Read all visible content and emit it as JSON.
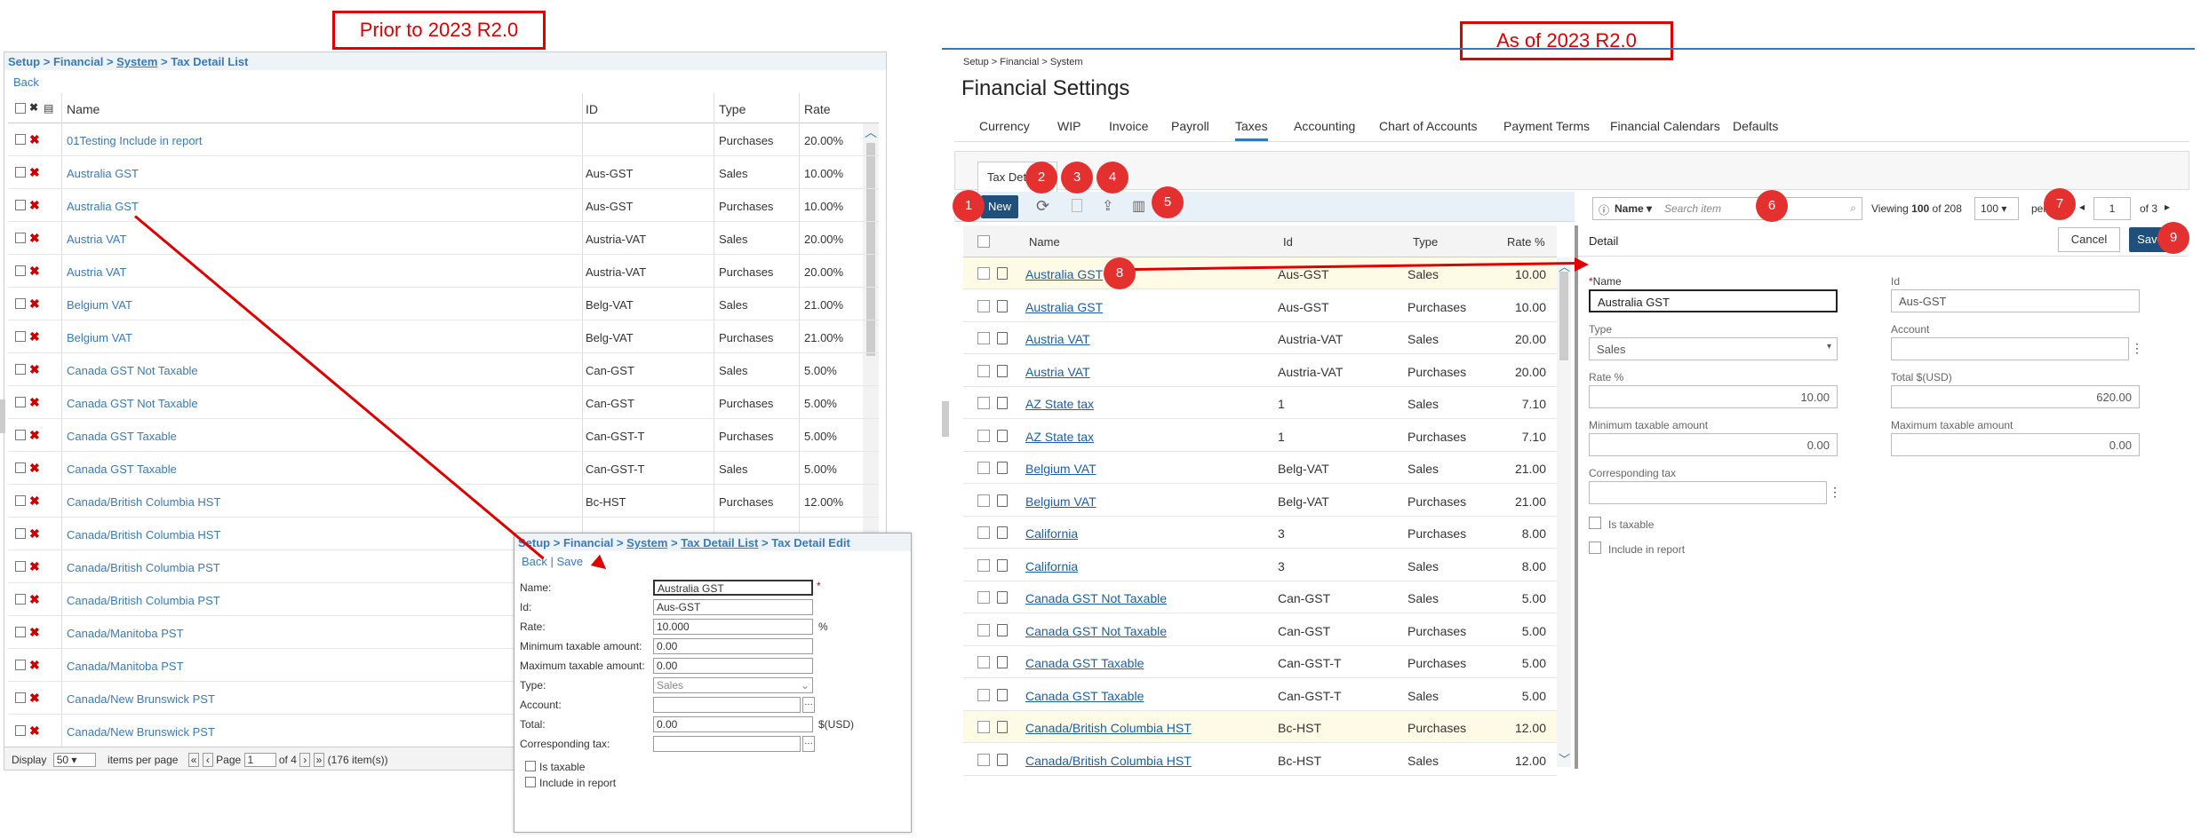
{
  "labels": {
    "prior": "Prior to 2023 R2.0",
    "asof": "As of 2023 R2.0"
  },
  "old": {
    "breadcrumb": [
      "Setup",
      "Financial",
      "System",
      "Tax Detail List"
    ],
    "back": "Back",
    "headers": {
      "name": "Name",
      "id": "ID",
      "type": "Type",
      "rate": "Rate"
    },
    "rows": [
      {
        "name": "01Testing Include in report",
        "id": "",
        "type": "Purchases",
        "rate": "20.00%"
      },
      {
        "name": "Australia GST",
        "id": "Aus-GST",
        "type": "Sales",
        "rate": "10.00%"
      },
      {
        "name": "Australia GST",
        "id": "Aus-GST",
        "type": "Purchases",
        "rate": "10.00%"
      },
      {
        "name": "Austria VAT",
        "id": "Austria-VAT",
        "type": "Sales",
        "rate": "20.00%"
      },
      {
        "name": "Austria VAT",
        "id": "Austria-VAT",
        "type": "Purchases",
        "rate": "20.00%"
      },
      {
        "name": "Belgium VAT",
        "id": "Belg-VAT",
        "type": "Sales",
        "rate": "21.00%"
      },
      {
        "name": "Belgium VAT",
        "id": "Belg-VAT",
        "type": "Purchases",
        "rate": "21.00%"
      },
      {
        "name": "Canada GST Not Taxable",
        "id": "Can-GST",
        "type": "Sales",
        "rate": "5.00%"
      },
      {
        "name": "Canada GST Not Taxable",
        "id": "Can-GST",
        "type": "Purchases",
        "rate": "5.00%"
      },
      {
        "name": "Canada GST Taxable",
        "id": "Can-GST-T",
        "type": "Purchases",
        "rate": "5.00%"
      },
      {
        "name": "Canada GST Taxable",
        "id": "Can-GST-T",
        "type": "Sales",
        "rate": "5.00%"
      },
      {
        "name": "Canada/British Columbia HST",
        "id": "Bc-HST",
        "type": "Purchases",
        "rate": "12.00%"
      },
      {
        "name": "Canada/British Columbia HST",
        "id": "",
        "type": "",
        "rate": ""
      },
      {
        "name": "Canada/British Columbia PST",
        "id": "",
        "type": "",
        "rate": ""
      },
      {
        "name": "Canada/British Columbia PST",
        "id": "",
        "type": "",
        "rate": ""
      },
      {
        "name": "Canada/Manitoba PST",
        "id": "",
        "type": "",
        "rate": ""
      },
      {
        "name": "Canada/Manitoba PST",
        "id": "",
        "type": "",
        "rate": ""
      },
      {
        "name": "Canada/New Brunswick PST",
        "id": "",
        "type": "",
        "rate": ""
      },
      {
        "name": "Canada/New Brunswick PST",
        "id": "",
        "type": "",
        "rate": ""
      }
    ],
    "footer": {
      "display": "Display",
      "display_value": "50",
      "items_per_page": "items per page",
      "page": "Page",
      "page_value": "1",
      "of": "of 4",
      "count": "(176 item(s))"
    },
    "popup": {
      "breadcrumb": [
        "Setup",
        "Financial",
        "System",
        "Tax Detail List",
        "Tax Detail Edit"
      ],
      "back": "Back",
      "save": "Save",
      "fields": {
        "name_label": "Name:",
        "name_value": "Australia GST",
        "id_label": "Id:",
        "id_value": "Aus-GST",
        "rate_label": "Rate:",
        "rate_value": "10.000",
        "rate_unit": "%",
        "min_label": "Minimum taxable amount:",
        "min_value": "0.00",
        "max_label": "Maximum taxable amount:",
        "max_value": "0.00",
        "type_label": "Type:",
        "type_value": "Sales",
        "account_label": "Account:",
        "total_label": "Total:",
        "total_value": "0.00",
        "total_unit": "$(USD)",
        "corr_label": "Corresponding tax:",
        "taxable_label": "Is taxable",
        "include_label": "Include in report"
      }
    }
  },
  "new": {
    "breadcrumb": "Setup > Financial > System",
    "title": "Financial Settings",
    "tabs": [
      "Currency",
      "WIP",
      "Invoice",
      "Payroll",
      "Taxes",
      "Accounting",
      "Chart of Accounts",
      "Payment Terms",
      "Financial Calendars",
      "Defaults"
    ],
    "active_tab": "Taxes",
    "subtab": "Tax Deta",
    "new_button": "New",
    "search": {
      "field": "Name",
      "placeholder": "Search item"
    },
    "viewing": "Viewing",
    "viewing_count": "100",
    "viewing_of": "of 208",
    "page_size": "100",
    "per": "per",
    "page": "1",
    "of_pages": "of 3",
    "headers": {
      "name": "Name",
      "id": "Id",
      "type": "Type",
      "rate": "Rate %"
    },
    "rows": [
      {
        "name": "Australia GST",
        "id": "Aus-GST",
        "type": "Sales",
        "rate": "10.00"
      },
      {
        "name": "Australia GST",
        "id": "Aus-GST",
        "type": "Purchases",
        "rate": "10.00"
      },
      {
        "name": "Austria VAT",
        "id": "Austria-VAT",
        "type": "Sales",
        "rate": "20.00"
      },
      {
        "name": "Austria VAT",
        "id": "Austria-VAT",
        "type": "Purchases",
        "rate": "20.00"
      },
      {
        "name": "AZ State tax",
        "id": "1",
        "type": "Sales",
        "rate": "7.10"
      },
      {
        "name": "AZ State tax",
        "id": "1",
        "type": "Purchases",
        "rate": "7.10"
      },
      {
        "name": "Belgium VAT",
        "id": "Belg-VAT",
        "type": "Sales",
        "rate": "21.00"
      },
      {
        "name": "Belgium VAT",
        "id": "Belg-VAT",
        "type": "Purchases",
        "rate": "21.00"
      },
      {
        "name": "California",
        "id": "3",
        "type": "Purchases",
        "rate": "8.00"
      },
      {
        "name": "California",
        "id": "3",
        "type": "Sales",
        "rate": "8.00"
      },
      {
        "name": "Canada GST Not Taxable",
        "id": "Can-GST",
        "type": "Sales",
        "rate": "5.00"
      },
      {
        "name": "Canada GST Not Taxable",
        "id": "Can-GST",
        "type": "Purchases",
        "rate": "5.00"
      },
      {
        "name": "Canada GST Taxable",
        "id": "Can-GST-T",
        "type": "Purchases",
        "rate": "5.00"
      },
      {
        "name": "Canada GST Taxable",
        "id": "Can-GST-T",
        "type": "Sales",
        "rate": "5.00"
      },
      {
        "name": "Canada/British Columbia HST",
        "id": "Bc-HST",
        "type": "Purchases",
        "rate": "12.00"
      },
      {
        "name": "Canada/British Columbia HST",
        "id": "Bc-HST",
        "type": "Sales",
        "rate": "12.00"
      }
    ],
    "detail": {
      "title": "Detail",
      "cancel": "Cancel",
      "save": "Save",
      "name_label": "Name",
      "name_required": "*",
      "name_value": "Australia GST",
      "id_label": "Id",
      "id_value": "Aus-GST",
      "type_label": "Type",
      "type_value": "Sales",
      "account_label": "Account",
      "rate_label": "Rate %",
      "rate_value": "10.00",
      "total_label": "Total $(USD)",
      "total_value": "620.00",
      "min_label": "Minimum taxable amount",
      "min_value": "0.00",
      "max_label": "Maximum taxable amount",
      "max_value": "0.00",
      "corr_label": "Corresponding tax",
      "taxable_label": "Is taxable",
      "include_label": "Include in report"
    },
    "markers": [
      "1",
      "2",
      "3",
      "4",
      "5",
      "6",
      "7",
      "8",
      "9"
    ]
  }
}
